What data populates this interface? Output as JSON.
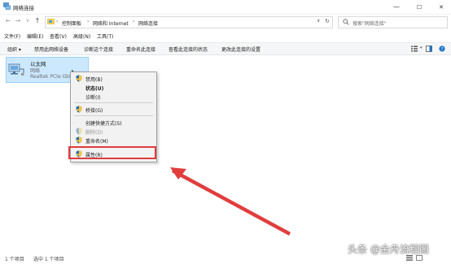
{
  "window": {
    "title": "网络连接",
    "minimize": "—",
    "maximize": "☐",
    "close": "✕"
  },
  "nav": {
    "back": "←",
    "forward": "→",
    "recent": "∨",
    "up": "↑"
  },
  "address": {
    "sep": "›",
    "crumbs": [
      "控制面板",
      "网络和 Internet",
      "网络连接"
    ],
    "dropdown": "∨",
    "refresh": "↻"
  },
  "search": {
    "placeholder": "搜索\"网络连接\""
  },
  "menubar": [
    "文件(F)",
    "编辑(E)",
    "查看(V)",
    "高级(N)",
    "工具(T)"
  ],
  "commands": [
    "组织 ▾",
    "禁用此网络设备",
    "诊断这个连接",
    "重命名此连接",
    "查看此连接的状态",
    "更改此连接的设置"
  ],
  "item": {
    "name": "以太网",
    "type": "网络",
    "device": "Realtek PCIe GbE"
  },
  "context_menu": {
    "disable": "禁用(B)",
    "status": "状态(U)",
    "diagnose": "诊断(I)",
    "bridge": "桥接(G)",
    "shortcut": "创建快捷方式(S)",
    "delete": "删除(D)",
    "rename": "重命名(M)",
    "properties": "属性(R)"
  },
  "status": {
    "count": "1 个项目",
    "selected": "选中 1 个项目"
  },
  "watermark": "头条 @金舟流程图",
  "colors": {
    "selection": "#cce8ff",
    "highlight_box": "#e03d3d",
    "arrow": "#e03d3d"
  }
}
